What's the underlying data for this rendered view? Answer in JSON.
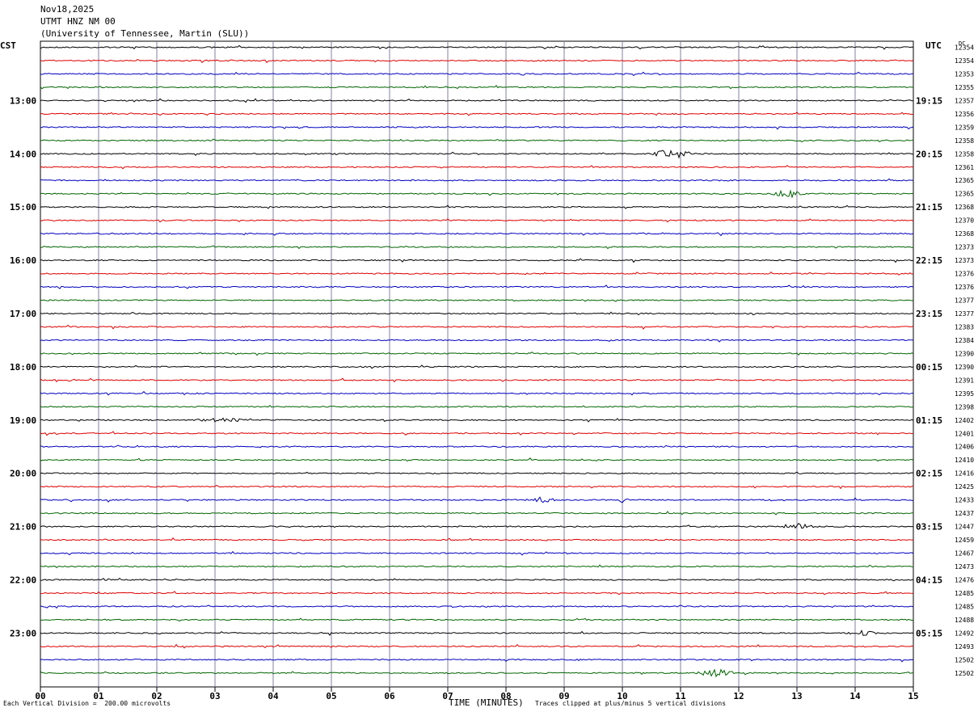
{
  "header": {
    "date": "Nov18,2025",
    "station": "UTMT HNZ NM 00",
    "network": "(University of Tennessee, Martin (SLU))"
  },
  "left_timezone": "CST",
  "right_timezone": "UTC",
  "dc_label": "DC",
  "footer": {
    "scale": "Each Vertical Division =  200.00 microvolts",
    "clip": "Traces clipped at plus/minus 5 vertical divisions"
  },
  "colors": {
    "series": [
      "#000000",
      "#e00000",
      "#0000c0",
      "#006400"
    ],
    "grid": "#8080a0"
  },
  "chart_data": {
    "type": "line",
    "title": "",
    "xlabel": "TIME (MINUTES)",
    "ylabel": "",
    "xlim": [
      0,
      15
    ],
    "x_ticks": [
      "00",
      "01",
      "02",
      "03",
      "04",
      "05",
      "06",
      "07",
      "08",
      "09",
      "10",
      "11",
      "12",
      "13",
      "14",
      "15"
    ],
    "trace_count": 48,
    "left_hour_labels": [
      "13:00",
      "14:00",
      "15:00",
      "16:00",
      "17:00",
      "18:00",
      "19:00",
      "20:00",
      "21:00",
      "22:00",
      "23:00"
    ],
    "right_hour_labels": [
      "19:15",
      "20:15",
      "21:15",
      "22:15",
      "23:15",
      "00:15",
      "01:15",
      "02:15",
      "03:15",
      "04:15",
      "05:15"
    ],
    "dc_offsets": [
      "12354",
      "12354",
      "12353",
      "12355",
      "12357",
      "12356",
      "12359",
      "12358",
      "12358",
      "12361",
      "12365",
      "12365",
      "12368",
      "12370",
      "12368",
      "12373",
      "12373",
      "12376",
      "12376",
      "12377",
      "12377",
      "12383",
      "12384",
      "12390",
      "12390",
      "12391",
      "12395",
      "12398",
      "12402",
      "12401",
      "12406",
      "12410",
      "12416",
      "12425",
      "12433",
      "12437",
      "12447",
      "12459",
      "12467",
      "12473",
      "12476",
      "12485",
      "12485",
      "12488",
      "12492",
      "12493",
      "12502",
      "12502"
    ],
    "events": [
      {
        "trace": 8,
        "minute": 10.85,
        "amplitude": 6,
        "duration_min": 0.4
      },
      {
        "trace": 11,
        "minute": 12.85,
        "amplitude": 5,
        "duration_min": 0.3
      },
      {
        "trace": 36,
        "minute": 13.0,
        "amplitude": 5,
        "duration_min": 0.3
      },
      {
        "trace": 44,
        "minute": 14.1,
        "amplitude": 3,
        "duration_min": 0.3
      },
      {
        "trace": 47,
        "minute": 11.6,
        "amplitude": 5,
        "duration_min": 0.35
      },
      {
        "trace": 28,
        "minute": 3.1,
        "amplitude": 2,
        "duration_min": 0.6
      },
      {
        "trace": 34,
        "minute": 8.6,
        "amplitude": 3,
        "duration_min": 0.3
      },
      {
        "trace": 34,
        "minute": 10.0,
        "amplitude": 3,
        "duration_min": 0.1
      }
    ]
  }
}
